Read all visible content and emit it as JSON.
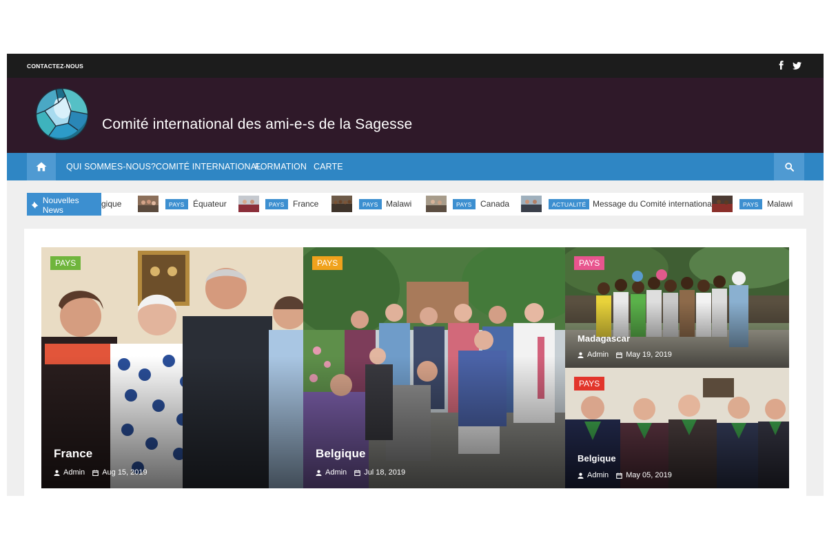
{
  "topbar": {
    "contact_label": "CONTACTEZ-NOUS",
    "social": [
      "facebook-icon",
      "twitter-icon"
    ]
  },
  "header": {
    "site_title": "Comité international des ami-e-s de la Sagesse"
  },
  "nav": {
    "items": [
      {
        "label": "QUI SOMMES-NOUS?"
      },
      {
        "label": "COMITÉ INTERNATIONAL"
      },
      {
        "label": "FORMATION"
      },
      {
        "label": "CARTE"
      }
    ]
  },
  "ticker": {
    "label": "Nouvelles News",
    "items": [
      {
        "badge": "",
        "text": "gique"
      },
      {
        "badge": "PAYS",
        "text": "Équateur"
      },
      {
        "badge": "PAYS",
        "text": "France"
      },
      {
        "badge": "PAYS",
        "text": "Malawi"
      },
      {
        "badge": "PAYS",
        "text": "Canada"
      },
      {
        "badge": "ACTUALITÉ",
        "text": "Message du Comité international"
      },
      {
        "badge": "PAYS",
        "text": "Malawi"
      }
    ]
  },
  "posts": [
    {
      "category": "PAYS",
      "category_color": "#6fb53c",
      "title": "France",
      "author": "Admin",
      "date": "Aug 15, 2019"
    },
    {
      "category": "PAYS",
      "category_color": "#f0a21c",
      "title": "Belgique",
      "author": "Admin",
      "date": "Jul 18, 2019"
    },
    {
      "category": "PAYS",
      "category_color": "#e8558e",
      "title": "Madagascar",
      "author": "Admin",
      "date": "May 19, 2019"
    },
    {
      "category": "PAYS",
      "category_color": "#e2352b",
      "title": "Belgique",
      "author": "Admin",
      "date": "May 05, 2019"
    }
  ],
  "colors": {
    "topbar": "#1c1c1c",
    "header": "#2f1929",
    "nav": "#2f86c4",
    "accent": "#3c8fd0"
  }
}
